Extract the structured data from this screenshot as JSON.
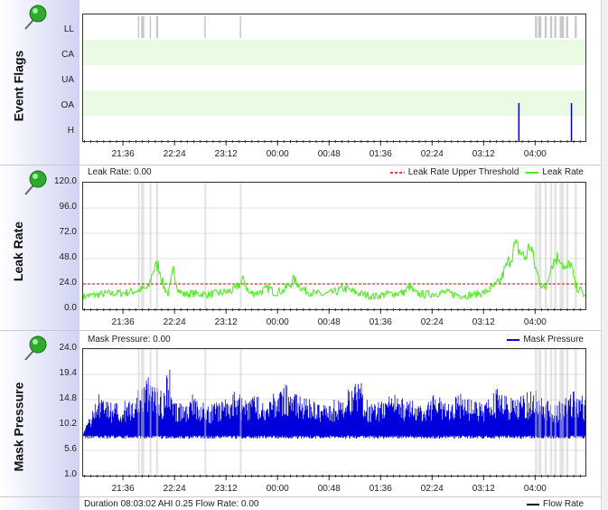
{
  "panels": {
    "flags": {
      "label": "Event Flags"
    },
    "leak": {
      "label": "Leak Rate",
      "info": "Leak Rate: 0.00"
    },
    "mask": {
      "label": "Mask Pressure",
      "info": "Mask Pressure: 0.00"
    },
    "flow": {
      "info": "Duration 08:03:02 AHI 0.25 Flow Rate: 0.00",
      "legend": "Flow Rate"
    }
  },
  "colors": {
    "flag_band": "#e9fbe3",
    "leak": "#44ee11",
    "threshold": "#dd0000",
    "pressure": "#0000dd",
    "shade": "#cccccc"
  },
  "chart_data": [
    {
      "type": "scatter",
      "title": "Event Flags",
      "categories": [
        "LL",
        "CA",
        "UA",
        "OA",
        "H"
      ],
      "x_ticks": [
        "21:36",
        "22:24",
        "23:12",
        "00:00",
        "00:48",
        "01:36",
        "02:24",
        "03:12",
        "04:00"
      ],
      "events": [
        {
          "flag": "LL",
          "ranges": [
            [
              "21:49",
              "21:50"
            ],
            [
              "21:52",
              "21:55"
            ],
            [
              "22:00",
              "22:01"
            ],
            [
              "22:06",
              "22:08"
            ],
            [
              "22:51",
              "22:52"
            ],
            [
              "23:24",
              "23:25"
            ],
            [
              "03:59",
              "04:01"
            ],
            [
              "04:02",
              "04:05"
            ],
            [
              "04:08",
              "04:10"
            ],
            [
              "04:13",
              "04:15"
            ],
            [
              "04:17",
              "04:19"
            ],
            [
              "04:22",
              "04:26"
            ],
            [
              "04:28",
              "04:30"
            ],
            [
              "04:36",
              "04:38"
            ]
          ]
        },
        {
          "flag": "H",
          "times": [
            "03:44",
            "04:33"
          ]
        }
      ]
    },
    {
      "type": "line",
      "title": "Leak Rate",
      "ylim": [
        0.0,
        120.0
      ],
      "y_ticks": [
        "0.0",
        "24.0",
        "48.0",
        "72.0",
        "96.0",
        "120.0"
      ],
      "x_ticks": [
        "21:36",
        "22:24",
        "23:12",
        "00:00",
        "00:48",
        "01:36",
        "02:24",
        "03:12",
        "04:00"
      ],
      "series": [
        {
          "name": "Leak Rate Upper Threshold",
          "style": "dashed",
          "values": [
            [
              0,
              24
            ],
            [
              100,
              24
            ]
          ]
        },
        {
          "name": "Leak Rate",
          "values": [
            [
              0,
              12
            ],
            [
              3,
              14
            ],
            [
              6,
              15
            ],
            [
              9,
              16
            ],
            [
              11,
              18
            ],
            [
              13,
              20
            ],
            [
              14,
              38
            ],
            [
              15,
              42
            ],
            [
              16,
              22
            ],
            [
              17,
              14
            ],
            [
              18,
              38
            ],
            [
              19,
              18
            ],
            [
              20,
              14
            ],
            [
              22,
              15
            ],
            [
              25,
              14
            ],
            [
              28,
              16
            ],
            [
              30,
              18
            ],
            [
              32,
              28
            ],
            [
              33,
              15
            ],
            [
              35,
              16
            ],
            [
              37,
              20
            ],
            [
              38,
              16
            ],
            [
              40,
              18
            ],
            [
              42,
              28
            ],
            [
              44,
              18
            ],
            [
              46,
              15
            ],
            [
              48,
              14
            ],
            [
              50,
              16
            ],
            [
              52,
              20
            ],
            [
              54,
              16
            ],
            [
              56,
              14
            ],
            [
              58,
              12
            ],
            [
              60,
              14
            ],
            [
              62,
              15
            ],
            [
              64,
              16
            ],
            [
              65,
              22
            ],
            [
              66,
              15
            ],
            [
              68,
              14
            ],
            [
              70,
              15
            ],
            [
              72,
              16
            ],
            [
              74,
              14
            ],
            [
              76,
              13
            ],
            [
              78,
              14
            ],
            [
              80,
              16
            ],
            [
              82,
              22
            ],
            [
              83,
              26
            ],
            [
              84,
              38
            ],
            [
              85,
              48
            ],
            [
              86,
              60
            ],
            [
              87,
              55
            ],
            [
              88,
              48
            ],
            [
              89,
              62
            ],
            [
              90,
              40
            ],
            [
              91,
              25
            ],
            [
              92,
              18
            ],
            [
              93,
              40
            ],
            [
              94,
              48
            ],
            [
              95,
              50
            ],
            [
              96,
              35
            ],
            [
              97,
              45
            ],
            [
              98,
              22
            ],
            [
              99,
              18
            ],
            [
              100,
              12
            ]
          ]
        }
      ]
    },
    {
      "type": "line",
      "title": "Mask Pressure",
      "ylim": [
        1.0,
        24.0
      ],
      "y_ticks": [
        "1.0",
        "5.6",
        "10.2",
        "14.8",
        "19.4",
        "24.0"
      ],
      "x_ticks": [
        "21:36",
        "22:24",
        "23:12",
        "00:00",
        "00:48",
        "01:36",
        "02:24",
        "03:12",
        "04:00"
      ],
      "series": [
        {
          "name": "Mask Pressure",
          "values": [
            [
              0,
              8.5
            ],
            [
              3,
              16
            ],
            [
              6,
              14
            ],
            [
              9,
              15
            ],
            [
              11,
              17
            ],
            [
              13,
              19
            ],
            [
              14,
              20
            ],
            [
              15,
              17
            ],
            [
              16,
              16
            ],
            [
              17,
              22
            ],
            [
              18,
              15
            ],
            [
              20,
              14
            ],
            [
              22,
              16
            ],
            [
              25,
              14
            ],
            [
              28,
              15
            ],
            [
              30,
              17
            ],
            [
              32,
              15
            ],
            [
              35,
              16
            ],
            [
              37,
              15
            ],
            [
              40,
              18
            ],
            [
              42,
              16
            ],
            [
              45,
              15
            ],
            [
              48,
              14
            ],
            [
              50,
              15
            ],
            [
              52,
              16
            ],
            [
              55,
              19
            ],
            [
              57,
              14
            ],
            [
              60,
              15
            ],
            [
              62,
              16
            ],
            [
              65,
              15
            ],
            [
              68,
              14
            ],
            [
              70,
              16
            ],
            [
              72,
              15
            ],
            [
              75,
              16
            ],
            [
              78,
              15
            ],
            [
              80,
              14
            ],
            [
              82,
              17
            ],
            [
              84,
              16
            ],
            [
              86,
              15
            ],
            [
              88,
              16
            ],
            [
              90,
              17
            ],
            [
              92,
              15
            ],
            [
              94,
              14
            ],
            [
              96,
              16
            ],
            [
              98,
              17
            ],
            [
              100,
              15
            ]
          ]
        }
      ]
    }
  ]
}
